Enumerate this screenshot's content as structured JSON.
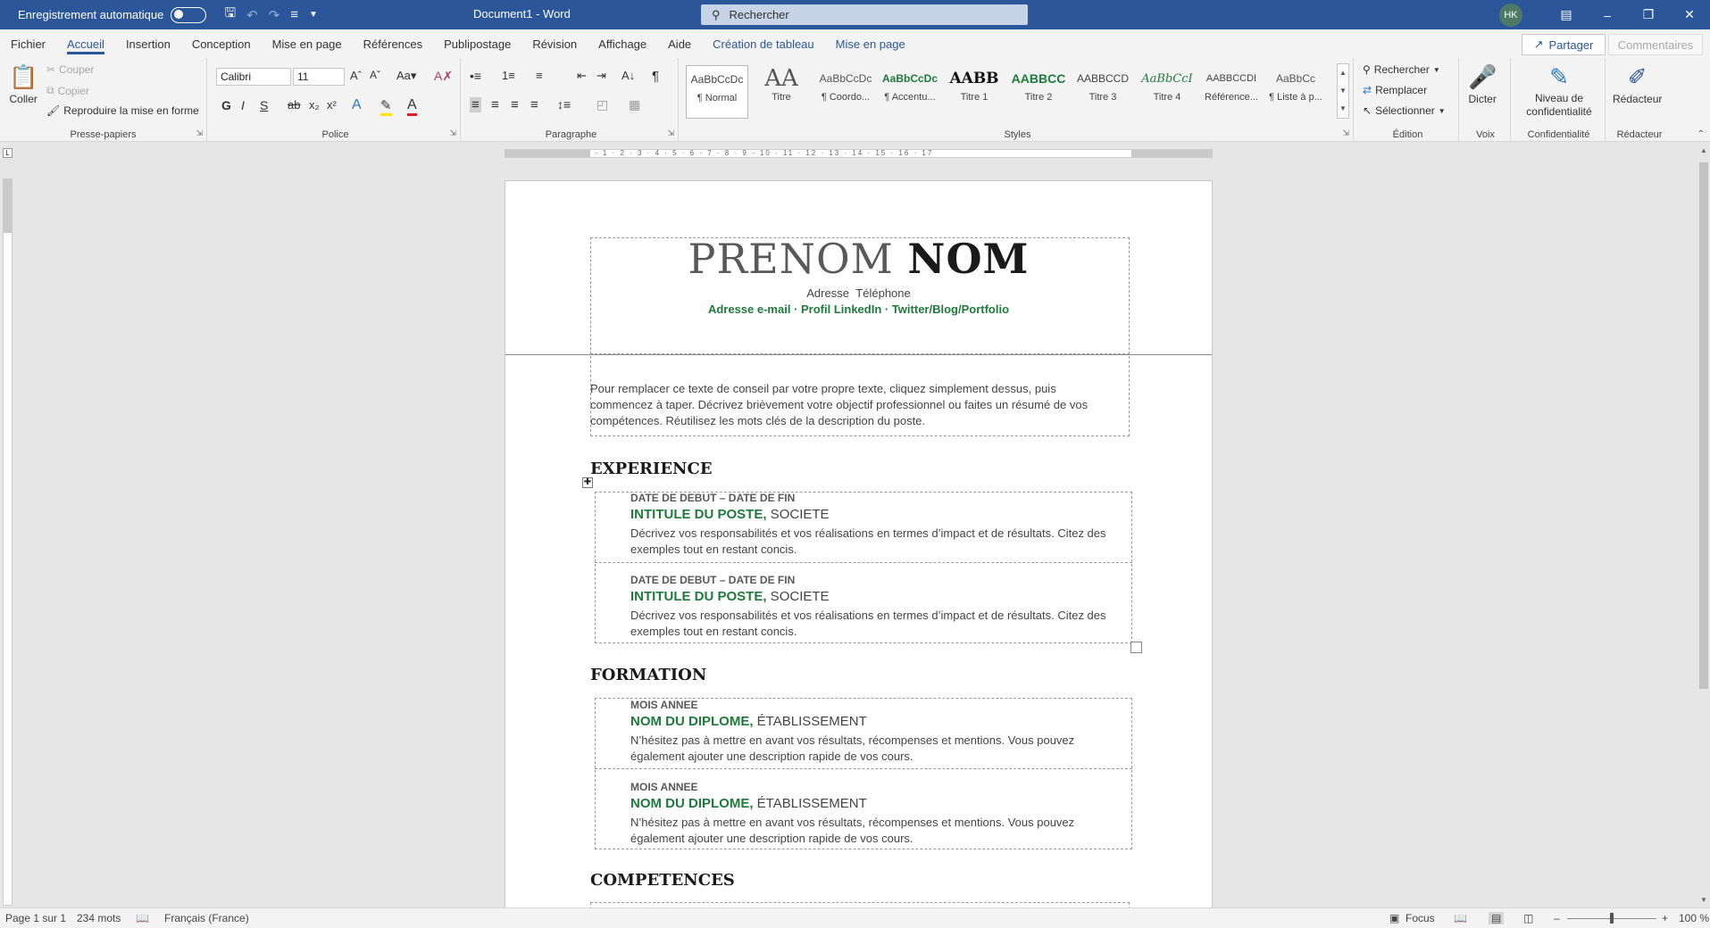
{
  "titlebar": {
    "autosave_label": "Enregistrement automatique",
    "doc_title": "Document1  -  Word",
    "search_placeholder": "Rechercher",
    "avatar_initials": "HK"
  },
  "menu": {
    "tabs": [
      "Fichier",
      "Accueil",
      "Insertion",
      "Conception",
      "Mise en page",
      "Références",
      "Publipostage",
      "Révision",
      "Affichage",
      "Aide",
      "Création de tableau",
      "Mise en page"
    ],
    "share_label": "Partager",
    "comments_label": "Commentaires"
  },
  "ribbon": {
    "clipboard": {
      "paste": "Coller",
      "cut": "Couper",
      "copy": "Copier",
      "format_painter": "Reproduire la mise en forme",
      "label": "Presse-papiers"
    },
    "font": {
      "family": "Calibri",
      "size": "11",
      "label": "Police",
      "bold": "G",
      "italic": "I",
      "underline": "S"
    },
    "paragraph": {
      "label": "Paragraphe"
    },
    "styles": {
      "label": "Styles",
      "items": [
        {
          "preview": "AaBbCcDc",
          "name": "¶ Normal"
        },
        {
          "preview": "AA",
          "name": "Titre"
        },
        {
          "preview": "AaBbCcDc",
          "name": "¶ Coordo..."
        },
        {
          "preview": "AaBbCcDc",
          "name": "¶ Accentu..."
        },
        {
          "preview": "AABB",
          "name": "Titre 1"
        },
        {
          "preview": "AABBCC",
          "name": "Titre 2"
        },
        {
          "preview": "AABBCCD",
          "name": "Titre 3"
        },
        {
          "preview": "AaBbCcI",
          "name": "Titre 4"
        },
        {
          "preview": "AABBCCDI",
          "name": "Référence..."
        },
        {
          "preview": "AaBbCc",
          "name": "¶ Liste à p..."
        }
      ]
    },
    "editing": {
      "find": "Rechercher",
      "replace": "Remplacer",
      "select": "Sélectionner",
      "label": "Édition"
    },
    "voice": {
      "dictate": "Dicter",
      "label": "Voix"
    },
    "sensitivity": {
      "button_line1": "Niveau de",
      "button_line2": "confidentialité",
      "label": "Confidentialité"
    },
    "editor": {
      "button": "Rédacteur",
      "label": "Rédacteur"
    }
  },
  "document": {
    "first_name": "PRENOM",
    "last_name": "NOM",
    "contact": "Adresse   Téléphone",
    "links": "Adresse e-mail · Profil LinkedIn · Twitter/Blog/Portfolio",
    "objective": "Pour remplacer ce texte de conseil par votre propre texte, cliquez simplement dessus, puis commencez à taper. Décrivez brièvement votre objectif professionnel ou faites un résumé de vos compétences. Réutilisez les mots clés de la description du poste.",
    "experience_heading": "EXPERIENCE",
    "experience": [
      {
        "dates": "DATE DE DEBUT – DATE DE FIN",
        "title": "INTITULE DU POSTE,",
        "company": " SOCIETE",
        "desc": "Décrivez vos responsabilités et vos réalisations en termes d’impact et de résultats. Citez des exemples tout en restant concis."
      },
      {
        "dates": "DATE DE DEBUT – DATE DE FIN",
        "title": "INTITULE DU POSTE,",
        "company": " SOCIETE",
        "desc": "Décrivez vos responsabilités et vos réalisations en termes d’impact et de résultats. Citez des exemples tout en restant concis."
      }
    ],
    "education_heading": "FORMATION",
    "education": [
      {
        "dates": "MOIS ANNEE",
        "title": "NOM DU DIPLOME,",
        "company": " ÉTABLISSEMENT",
        "desc": "N’hésitez pas à mettre en avant vos résultats, récompenses et mentions. Vous pouvez également ajouter une description rapide de vos cours."
      },
      {
        "dates": "MOIS ANNEE",
        "title": "NOM DU DIPLOME,",
        "company": " ÉTABLISSEMENT",
        "desc": "N’hésitez pas à mettre en avant vos résultats, récompenses et mentions. Vous pouvez également ajouter une description rapide de vos cours."
      }
    ],
    "skills_heading": "COMPETENCES"
  },
  "statusbar": {
    "page": "Page 1 sur 1",
    "words": "234 mots",
    "language": "Français (France)",
    "focus": "Focus",
    "zoom": "100 %"
  },
  "colors": {
    "brand": "#2b579a",
    "accent_green": "#1e7b3c"
  }
}
